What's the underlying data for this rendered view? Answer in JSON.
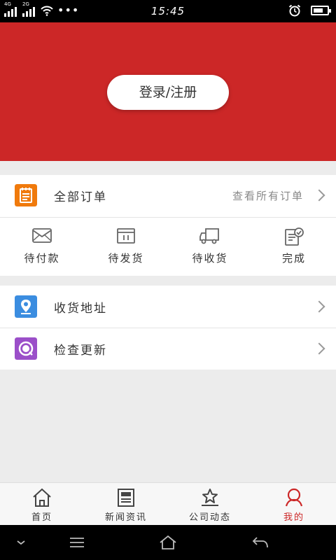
{
  "status_bar": {
    "time": "15:45",
    "sim1_network": "4G",
    "sim2_network": "2G",
    "more": "•••"
  },
  "header": {
    "login_label": "登录/注册",
    "background_color": "#cc2727"
  },
  "orders": {
    "title": "全部订单",
    "view_all": "查看所有订单",
    "icon": "order-list-icon",
    "icon_color": "#f07a0c",
    "statuses": [
      {
        "label": "待付款",
        "icon": "envelope-icon"
      },
      {
        "label": "待发货",
        "icon": "package-icon"
      },
      {
        "label": "待收货",
        "icon": "truck-icon"
      },
      {
        "label": "完成",
        "icon": "checklist-icon"
      }
    ]
  },
  "menu": [
    {
      "label": "收货地址",
      "icon": "location-icon",
      "icon_color": "#3b8de0"
    },
    {
      "label": "检查更新",
      "icon": "update-icon",
      "icon_color": "#9b4fc9"
    }
  ],
  "tabbar": {
    "active_color": "#cc2727",
    "tabs": [
      {
        "label": "首页",
        "icon": "home-icon",
        "active": false
      },
      {
        "label": "新闻资讯",
        "icon": "newspaper-icon",
        "active": false
      },
      {
        "label": "公司动态",
        "icon": "star-podium-icon",
        "active": false
      },
      {
        "label": "我的",
        "icon": "user-icon",
        "active": true
      }
    ]
  },
  "system_nav": [
    "chevron-down-icon",
    "menu-icon",
    "home-icon",
    "back-icon"
  ]
}
